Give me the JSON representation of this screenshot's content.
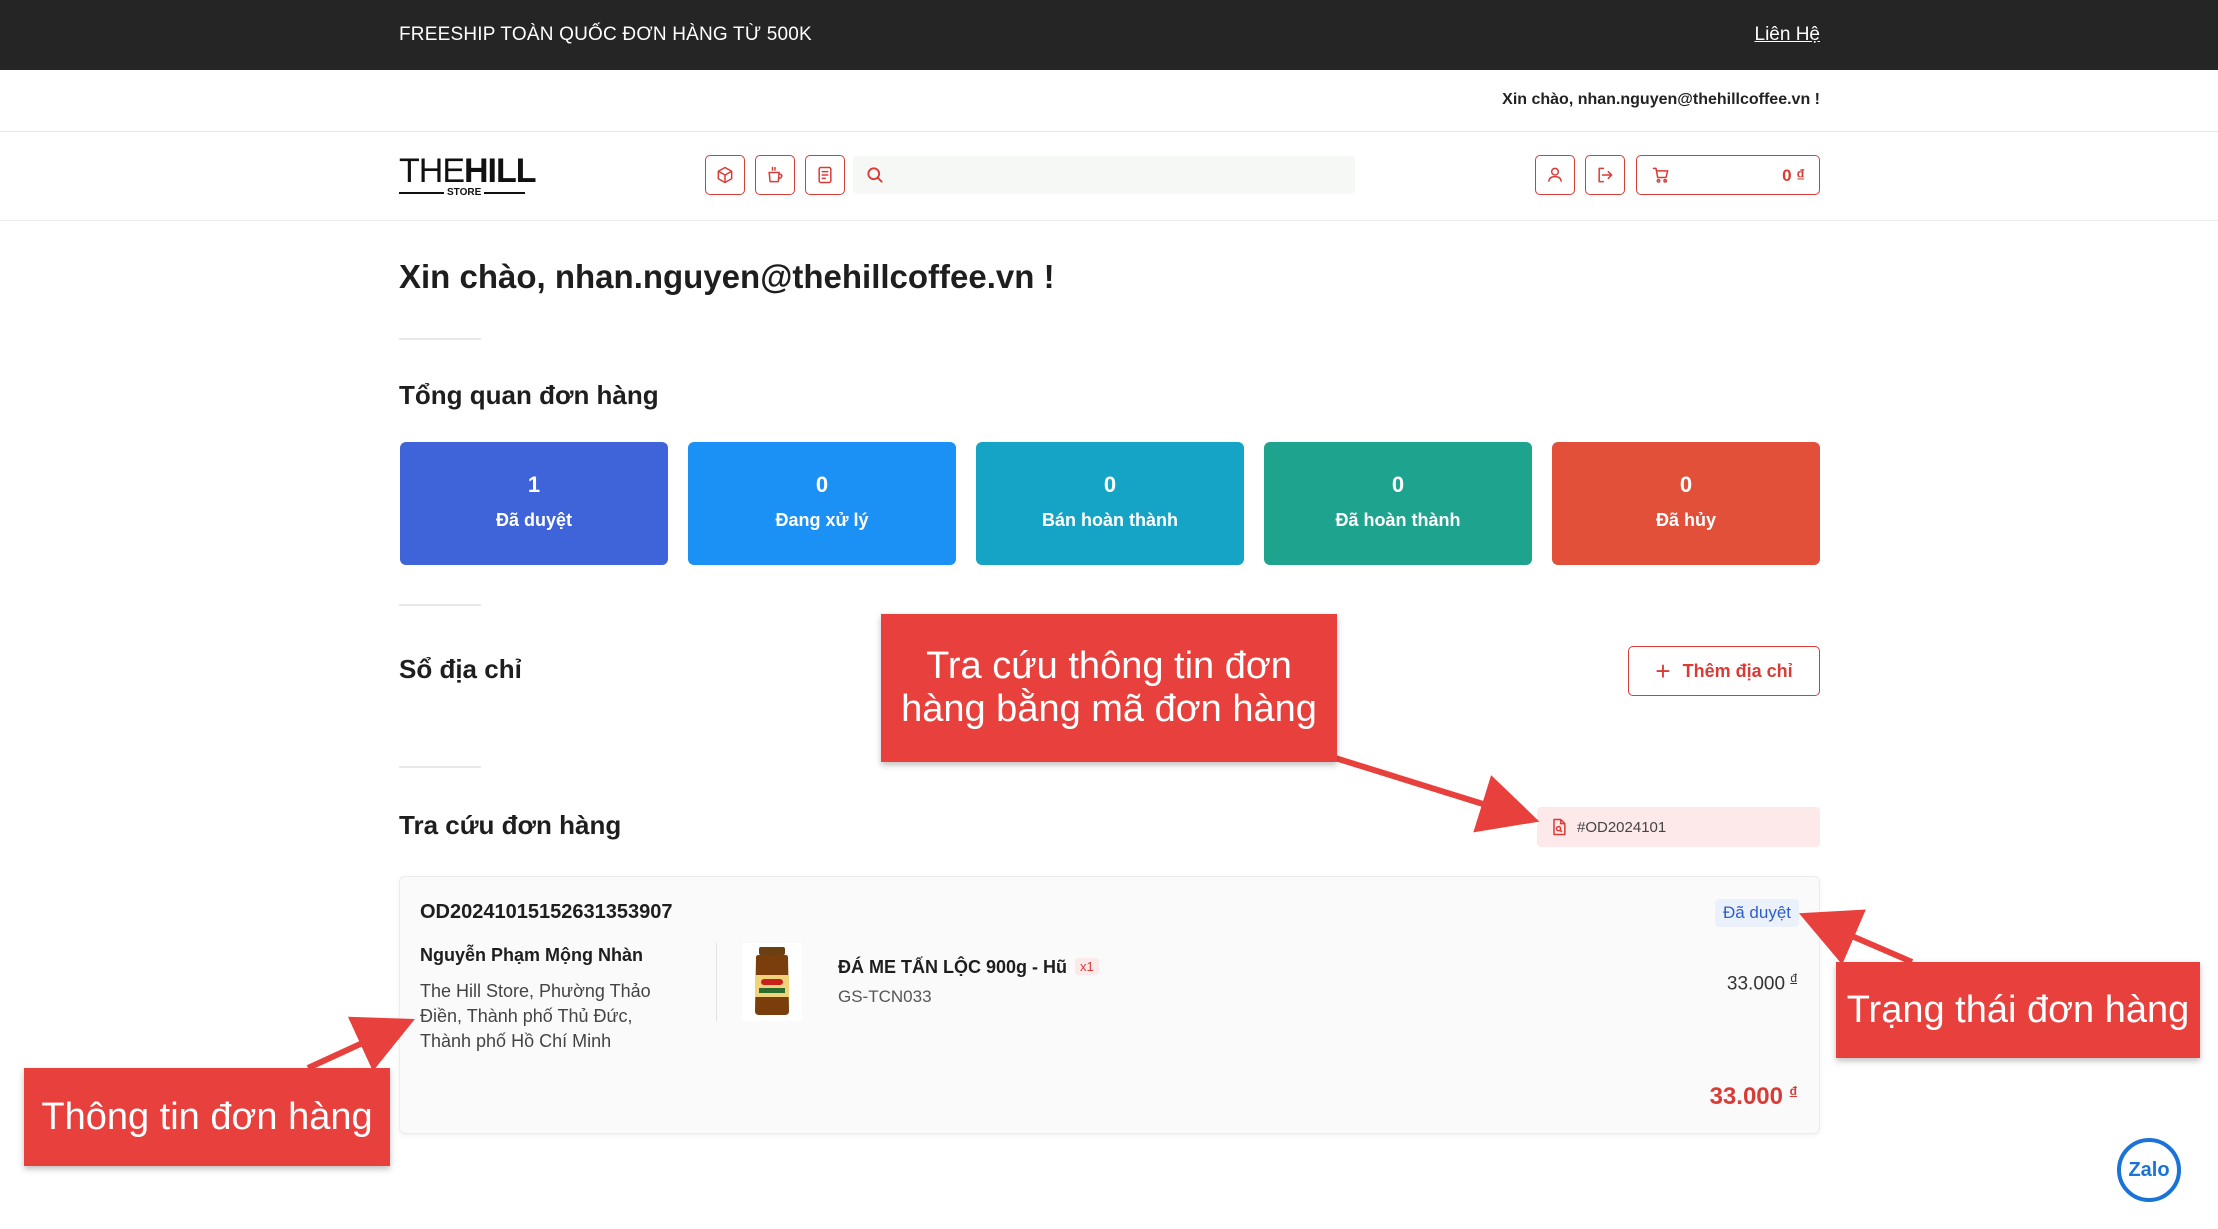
{
  "topbar": {
    "promo": "FREESHIP TOÀN QUỐC ĐƠN HÀNG TỪ 500K",
    "contact": "Liên Hệ"
  },
  "account": {
    "greeting": "Xin chào, nhan.nguyen@thehillcoffee.vn !"
  },
  "header": {
    "logo": "THEHILL",
    "logo_sub": "STORE",
    "search": {
      "value": "",
      "placeholder": ""
    },
    "cart_total": "0 ₫"
  },
  "main": {
    "title": "Xin chào, nhan.nguyen@thehillcoffee.vn !",
    "overview_title": "Tổng quan đơn hàng",
    "stats": [
      {
        "count": "1",
        "label": "Đã duyệt",
        "color": "#3f63d8"
      },
      {
        "count": "0",
        "label": "Đang xử lý",
        "color": "#1b90f5"
      },
      {
        "count": "0",
        "label": "Bán hoàn thành",
        "color": "#16a4c6"
      },
      {
        "count": "0",
        "label": "Đã hoàn thành",
        "color": "#1da38e"
      },
      {
        "count": "0",
        "label": "Đã hủy",
        "color": "#e2503a"
      }
    ],
    "address_title": "Sổ địa chỉ",
    "add_address": "Thêm địa chỉ",
    "lookup_title": "Tra cứu đơn hàng",
    "lookup_value": "#OD2024101"
  },
  "order": {
    "id": "OD20241015152631353907",
    "status": "Đã duyệt",
    "customer_name": "Nguyễn Phạm Mộng Nhàn",
    "address": "The Hill Store, Phường Thảo Điền, Thành phố Thủ Đức, Thành phố Hồ Chí Minh",
    "product_name": "ĐÁ ME TẤN LỘC 900g - Hũ",
    "qty": "x1",
    "sku": "GS-TCN033",
    "price": "33.000",
    "total": "33.000",
    "currency": "đ"
  },
  "annotations": {
    "lookup": "Tra cứu thông tin đơn hàng bằng mã đơn hàng",
    "status": "Trạng thái đơn hàng",
    "info": "Thông tin đơn hàng"
  },
  "zalo": "Zalo",
  "colors": {
    "brand_red": "#d93b36",
    "callout_red": "#e8413d",
    "topbar": "#252525"
  }
}
